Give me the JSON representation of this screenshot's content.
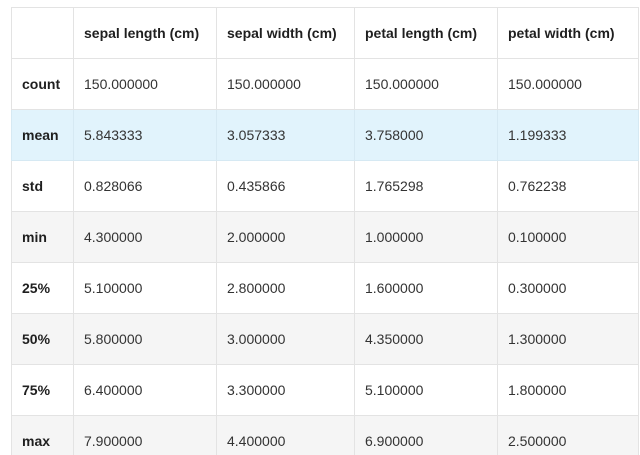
{
  "table": {
    "corner": "",
    "columns": [
      "sepal length (cm)",
      "sepal width (cm)",
      "petal length (cm)",
      "petal width (cm)"
    ],
    "rows": [
      {
        "label": "count",
        "values": [
          "150.000000",
          "150.000000",
          "150.000000",
          "150.000000"
        ]
      },
      {
        "label": "mean",
        "values": [
          "5.843333",
          "3.057333",
          "3.758000",
          "1.199333"
        ]
      },
      {
        "label": "std",
        "values": [
          "0.828066",
          "0.435866",
          "1.765298",
          "0.762238"
        ]
      },
      {
        "label": "min",
        "values": [
          "4.300000",
          "2.000000",
          "1.000000",
          "0.100000"
        ]
      },
      {
        "label": "25%",
        "values": [
          "5.100000",
          "2.800000",
          "1.600000",
          "0.300000"
        ]
      },
      {
        "label": "50%",
        "values": [
          "5.800000",
          "3.000000",
          "4.350000",
          "1.300000"
        ]
      },
      {
        "label": "75%",
        "values": [
          "6.400000",
          "3.300000",
          "5.100000",
          "1.800000"
        ]
      },
      {
        "label": "max",
        "values": [
          "7.900000",
          "4.400000",
          "6.900000",
          "2.500000"
        ]
      }
    ],
    "highlighted_row": "mean"
  },
  "colors": {
    "row_highlight": "#e1f3fc",
    "row_stripe": "#f5f5f5",
    "border": "#e3e3e3"
  }
}
